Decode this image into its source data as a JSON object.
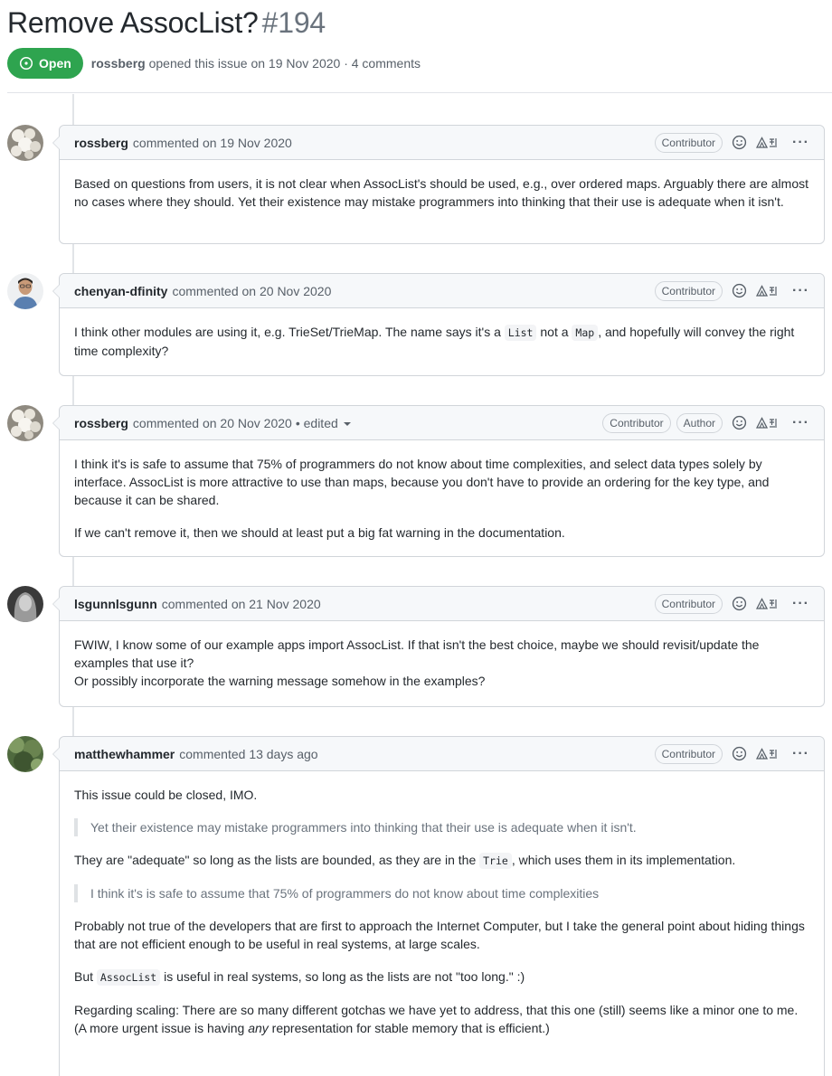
{
  "issue": {
    "title": "Remove AssocList?",
    "number": "#194",
    "state": "Open",
    "author": "rossberg",
    "opened_text": "opened this issue on 19 Nov 2020 · 4 comments"
  },
  "labels": {
    "commented": "commented",
    "contributor": "Contributor",
    "author_badge": "Author",
    "edited": "• edited",
    "more": "···"
  },
  "comments": [
    {
      "author": "rossberg",
      "date": "on 19 Nov 2020",
      "p1": "Based on questions from users, it is not clear when AssocList's should be used, e.g., over ordered maps. Arguably there are almost no cases where they should. Yet their existence may mistake programmers into thinking that their use is adequate when it isn't."
    },
    {
      "author": "chenyan-dfinity",
      "date": "on 20 Nov 2020",
      "p1_a": "I think other modules are using it, e.g. TrieSet/TrieMap. The name says it's a ",
      "code1": "List",
      "p1_b": " not a ",
      "code2": "Map",
      "p1_c": ", and hopefully will convey the right time complexity?"
    },
    {
      "author": "rossberg",
      "date": "on 20 Nov 2020",
      "p1": "I think it's is safe to assume that 75% of programmers do not know about time complexities, and select data types solely by interface. AssocList is more attractive to use than maps, because you don't have to provide an ordering for the key type, and because it can be shared.",
      "p2": "If we can't remove it, then we should at least put a big fat warning in the documentation."
    },
    {
      "author": "lsgunnlsgunn",
      "date": "on 21 Nov 2020",
      "p1_a": "FWIW, I know some of our example apps import AssocList. If that isn't the best choice, maybe we should revisit/update the examples that use it?",
      "p1_b": "Or possibly incorporate the warning message somehow in the examples?"
    },
    {
      "author": "matthewhammer",
      "date": "13 days ago",
      "p1": "This issue could be closed, IMO.",
      "quote1": "Yet their existence may mistake programmers into thinking that their use is adequate when it isn't.",
      "p2_a": "They are \"adequate\" so long as the lists are bounded, as they are in the ",
      "code1": "Trie",
      "p2_b": ", which uses them in its implementation.",
      "quote2": "I think it's is safe to assume that 75% of programmers do not know about time complexities",
      "p3": "Probably not true of the developers that are first to approach the Internet Computer, but I take the general point about hiding things that are not efficient enough to be useful in real systems, at large scales.",
      "p4_a": "But ",
      "code2": "AssocList",
      "p4_b": " is useful in real systems, so long as the lists are not \"too long.\" :)",
      "p5_a": "Regarding scaling: There are so many different gotchas we have yet to address, that this one (still) seems like a minor one to me. (A more urgent issue is having ",
      "p5_em": "any",
      "p5_b": " representation for stable memory that is efficient.)"
    }
  ]
}
